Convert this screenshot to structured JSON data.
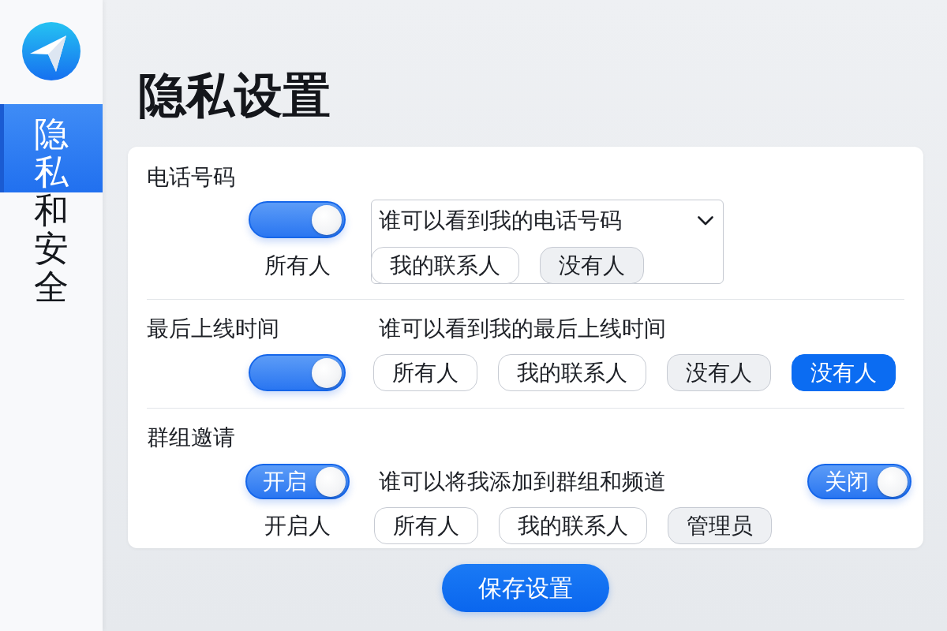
{
  "sidebar": {
    "items": [
      {
        "label": "隐私和安全",
        "selected": true
      }
    ]
  },
  "title": "隐私设置",
  "sections": [
    {
      "kind": "dropdown",
      "label": "电话号码",
      "toggle": {
        "on": true
      },
      "caption": "所有人",
      "dropdown": {
        "value": "谁可以看到我的电话号码"
      },
      "options": [
        {
          "label": "我的联系人",
          "selected": false,
          "highlighted": false
        },
        {
          "label": "没有人",
          "selected": false,
          "highlighted": true
        }
      ]
    },
    {
      "kind": "chips",
      "label": "最后上线时间",
      "question": "谁可以看到我的最后上线时间",
      "toggle": {
        "on": true
      },
      "options": [
        {
          "label": "所有人",
          "selected": false,
          "highlighted": false
        },
        {
          "label": "我的联系人",
          "selected": false,
          "highlighted": false
        },
        {
          "label": "没有人",
          "selected": false,
          "highlighted": true
        },
        {
          "label": "没有人",
          "selected": true,
          "highlighted": false
        }
      ]
    },
    {
      "kind": "toggles",
      "label": "群组邀请",
      "toggle": {
        "on": true,
        "label": "开启"
      },
      "question": "谁可以将我添加到群组和频道",
      "extra_toggle": {
        "on": true,
        "label": "关闭"
      },
      "caption": "开启人",
      "options": [
        {
          "label": "所有人",
          "selected": false,
          "highlighted": false
        },
        {
          "label": "我的联系人",
          "selected": false,
          "highlighted": false
        },
        {
          "label": "管理员",
          "selected": false,
          "highlighted": true
        }
      ]
    }
  ],
  "save_button": {
    "label": "保存设置"
  }
}
